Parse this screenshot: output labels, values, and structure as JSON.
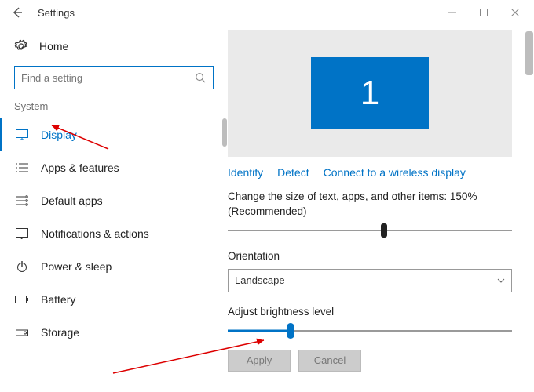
{
  "window": {
    "title": "Settings"
  },
  "sidebar": {
    "home": "Home",
    "search_placeholder": "Find a setting",
    "group": "System",
    "items": [
      {
        "label": "Display"
      },
      {
        "label": "Apps & features"
      },
      {
        "label": "Default apps"
      },
      {
        "label": "Notifications & actions"
      },
      {
        "label": "Power & sleep"
      },
      {
        "label": "Battery"
      },
      {
        "label": "Storage"
      }
    ]
  },
  "display": {
    "monitor_number": "1",
    "links": {
      "identify": "Identify",
      "detect": "Detect",
      "wireless": "Connect to a wireless display"
    },
    "scale_label": "Change the size of text, apps, and other items: 150% (Recommended)",
    "orientation_label": "Orientation",
    "orientation_value": "Landscape",
    "brightness_label": "Adjust brightness level",
    "buttons": {
      "apply": "Apply",
      "cancel": "Cancel"
    }
  }
}
